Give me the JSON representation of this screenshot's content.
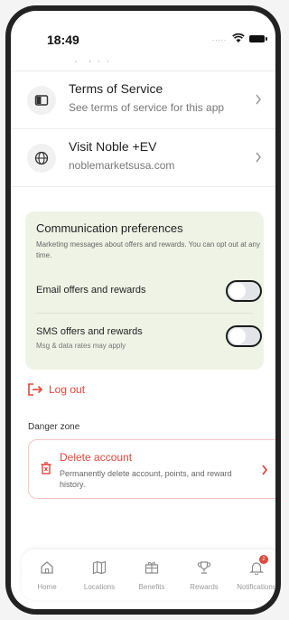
{
  "status_bar": {
    "time": "18:49",
    "signal": "....."
  },
  "menu": [
    {
      "title": "Terms of Service",
      "subtitle": "See terms of service for this app",
      "icon": "book-icon"
    },
    {
      "title": "Visit Noble +EV",
      "subtitle": "noblemarketsusa.com",
      "icon": "globe-icon"
    }
  ],
  "communication": {
    "title": "Communication preferences",
    "description": "Marketing messages about offers and rewards. You can opt out at any time.",
    "email_label": "Email offers and rewards",
    "email_enabled": false,
    "sms_label": "SMS offers and rewards",
    "sms_sublabel": "Msg & data rates may apply",
    "sms_enabled": false
  },
  "logout_label": "Log out",
  "danger": {
    "heading": "Danger zone",
    "title": "Delete account",
    "description": "Permanently delete account, points, and reward history."
  },
  "tabs": [
    {
      "label": "Home",
      "icon": "home-icon"
    },
    {
      "label": "Locations",
      "icon": "map-icon"
    },
    {
      "label": "Benefits",
      "icon": "gift-icon"
    },
    {
      "label": "Rewards",
      "icon": "trophy-icon"
    },
    {
      "label": "Notifications",
      "icon": "bell-icon",
      "badge": "2"
    }
  ],
  "colors": {
    "accent": "#e0463c",
    "card_bg": "#eff3e5",
    "muted": "#9a9a9a"
  }
}
